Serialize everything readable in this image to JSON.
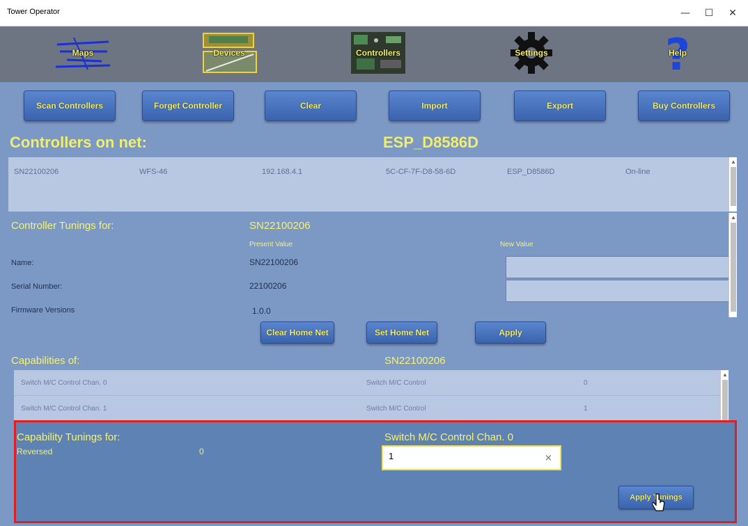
{
  "window": {
    "title": "Tower Operator",
    "minimize": "—",
    "maximize": "☐",
    "close": "✕"
  },
  "nav": {
    "maps": "Maps",
    "devices": "Devices",
    "controllers": "Controllers",
    "settings": "Settings",
    "help": "Help"
  },
  "toolbar": {
    "scan": "Scan Controllers",
    "forget": "Forget Controller",
    "clear": "Clear",
    "import": "Import",
    "export": "Export",
    "buy": "Buy Controllers"
  },
  "controllers_heading": "Controllers on net:",
  "net_name": "ESP_D8586D",
  "controller_row": {
    "serial": "SN22100206",
    "model": "WFS-46",
    "ip": "192.168.4.1",
    "mac": "5C-CF-7F-D8-58-6D",
    "network": "ESP_D8586D",
    "status": "On-line"
  },
  "tunings": {
    "heading": "Controller Tunings for:",
    "controller_id": "SN22100206",
    "present_value_label": "Present Value",
    "new_value_label": "New Value",
    "fields": [
      {
        "label": "Name:",
        "value": "SN22100206"
      },
      {
        "label": "Serial Number:",
        "value": "22100206"
      },
      {
        "label": "Firmware Versions",
        "value": "1.0.0"
      }
    ],
    "clear_home_net": "Clear Home Net",
    "set_home_net": "Set Home Net",
    "apply": "Apply"
  },
  "capabilities": {
    "heading": "Capabilities of:",
    "controller_id": "SN22100206",
    "rows": [
      {
        "name": "Switch M/C Control Chan. 0",
        "type": "Switch M/C Control",
        "channel": "0"
      },
      {
        "name": "Switch M/C Control Chan. 1",
        "type": "Switch M/C Control",
        "channel": "1"
      }
    ]
  },
  "capability_tunings": {
    "heading": "Capability Tunings for:",
    "capability": "Switch M/C Control Chan. 0",
    "param_label": "Reversed",
    "param_value": "0",
    "input_value": "1",
    "clear_glyph": "×",
    "apply_button": "Apply Tunings"
  },
  "colors": {
    "accent_text": "#f7f36a",
    "panel_bg": "#7c98c4",
    "button_bg": "#4a74bf",
    "highlight": "#e02020"
  },
  "icons": [
    "maps-icon",
    "devices-icon",
    "controllers-icon",
    "settings-gear-icon",
    "help-question-icon",
    "mouse-cursor-icon"
  ]
}
